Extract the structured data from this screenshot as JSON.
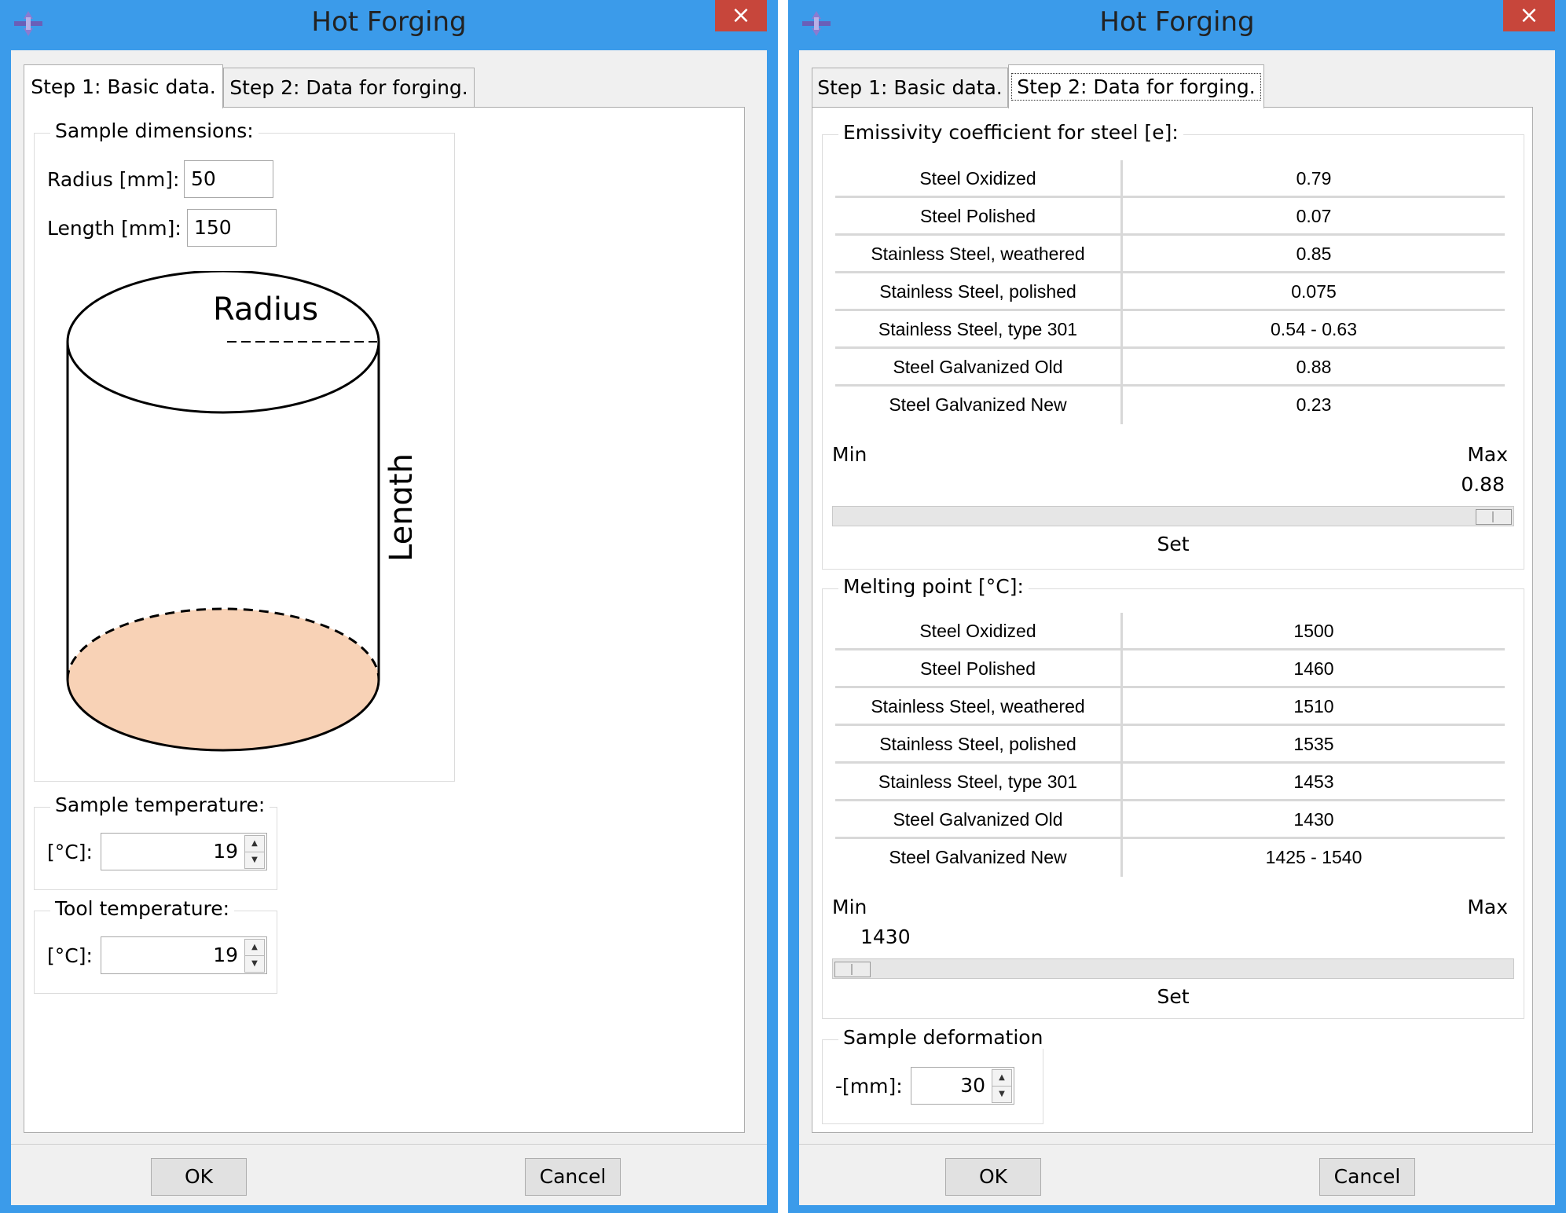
{
  "left": {
    "title": "Hot Forging",
    "close": "×",
    "tabs": [
      "Step 1: Basic data.",
      "Step 2: Data for forging."
    ],
    "sample_dimensions": {
      "label": "Sample dimensions:",
      "radius_label": "Radius [mm]:",
      "radius_value": "50",
      "length_label": "Length [mm]:",
      "length_value": "150",
      "diagram_radius": "Radius",
      "diagram_length": "Length",
      "fill_color": "#f8d2b6"
    },
    "sample_temperature": {
      "label": "Sample temperature:",
      "unit": "[°C]:",
      "value": "19"
    },
    "tool_temperature": {
      "label": "Tool temperature:",
      "unit": "[°C]:",
      "value": "19"
    },
    "ok": "OK",
    "cancel": "Cancel"
  },
  "right": {
    "title": "Hot Forging",
    "close": "×",
    "tabs": [
      "Step 1: Basic data.",
      "Step 2: Data for forging."
    ],
    "emissivity": {
      "label": "Emissivity coefficient for steel [e]:",
      "rows": [
        {
          "name": "Steel Oxidized",
          "value": "0.79"
        },
        {
          "name": "Steel Polished",
          "value": "0.07"
        },
        {
          "name": "Stainless Steel, weathered",
          "value": "0.85"
        },
        {
          "name": "Stainless Steel, polished",
          "value": "0.075"
        },
        {
          "name": "Stainless Steel, type 301",
          "value": "0.54 - 0.63"
        },
        {
          "name": "Steel Galvanized Old",
          "value": "0.88"
        },
        {
          "name": "Steel Galvanized New",
          "value": "0.23"
        }
      ],
      "min_label": "Min",
      "max_label": "Max",
      "slider_value": "0.88",
      "slider_position": 1.0,
      "set_label": "Set"
    },
    "melting": {
      "label": "Melting point [°C]:",
      "rows": [
        {
          "name": "Steel Oxidized",
          "value": "1500"
        },
        {
          "name": "Steel Polished",
          "value": "1460"
        },
        {
          "name": "Stainless Steel, weathered",
          "value": "1510"
        },
        {
          "name": "Stainless Steel, polished",
          "value": "1535"
        },
        {
          "name": "Stainless Steel, type 301",
          "value": "1453"
        },
        {
          "name": "Steel Galvanized Old",
          "value": "1430"
        },
        {
          "name": "Steel Galvanized New",
          "value": "1425 - 1540"
        }
      ],
      "min_label": "Min",
      "max_label": "Max",
      "slider_value": "1430",
      "slider_position": 0.0,
      "set_label": "Set"
    },
    "deformation": {
      "label": "Sample deformation",
      "unit": "-[mm]:",
      "value": "30"
    },
    "ok": "OK",
    "cancel": "Cancel"
  },
  "colors": {
    "frame": "#3b9bea",
    "close": "#c7463b",
    "panel": "#f0f0f0"
  }
}
